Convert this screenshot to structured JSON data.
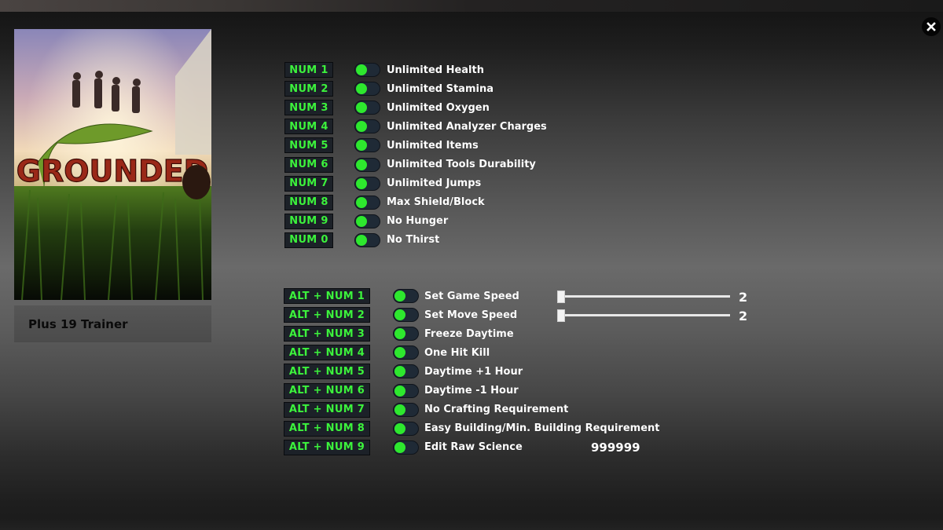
{
  "window": {
    "close_icon": "close-icon"
  },
  "game": {
    "title": "GROUNDED",
    "trainer_label": "Plus 19 Trainer"
  },
  "colors": {
    "hotkey_text": "#3cf23c",
    "toggle_knob": "#2ee82e",
    "toggle_track": "#1f2a36",
    "label_text": "#ffffff"
  },
  "cheats_basic": [
    {
      "key": "NUM 1",
      "label": "Unlimited Health",
      "enabled": false
    },
    {
      "key": "NUM 2",
      "label": "Unlimited Stamina",
      "enabled": false
    },
    {
      "key": "NUM 3",
      "label": "Unlimited Oxygen",
      "enabled": false
    },
    {
      "key": "NUM 4",
      "label": "Unlimited Analyzer Charges",
      "enabled": false
    },
    {
      "key": "NUM 5",
      "label": "Unlimited Items",
      "enabled": false
    },
    {
      "key": "NUM 6",
      "label": "Unlimited Tools Durability",
      "enabled": false
    },
    {
      "key": "NUM 7",
      "label": "Unlimited Jumps",
      "enabled": false
    },
    {
      "key": "NUM 8",
      "label": "Max Shield/Block",
      "enabled": false
    },
    {
      "key": "NUM 9",
      "label": "No Hunger",
      "enabled": false
    },
    {
      "key": "NUM 0",
      "label": "No Thirst",
      "enabled": false
    }
  ],
  "cheats_alt": [
    {
      "key": "ALT + NUM 1",
      "label": "Set Game Speed",
      "enabled": false,
      "slider_value": "2",
      "slider_fraction": 0
    },
    {
      "key": "ALT + NUM 2",
      "label": "Set Move Speed",
      "enabled": false,
      "slider_value": "2",
      "slider_fraction": 0
    },
    {
      "key": "ALT + NUM 3",
      "label": "Freeze Daytime",
      "enabled": false
    },
    {
      "key": "ALT + NUM 4",
      "label": "One Hit Kill",
      "enabled": false
    },
    {
      "key": "ALT + NUM 5",
      "label": "Daytime +1 Hour",
      "enabled": false
    },
    {
      "key": "ALT + NUM 6",
      "label": "Daytime -1 Hour",
      "enabled": false
    },
    {
      "key": "ALT + NUM 7",
      "label": "No Crafting Requirement",
      "enabled": false
    },
    {
      "key": "ALT + NUM 8",
      "label": "Easy Building/Min. Building Requirement",
      "enabled": false
    },
    {
      "key": "ALT + NUM 9",
      "label": "Edit Raw Science",
      "enabled": false,
      "input_value": "999999"
    }
  ]
}
